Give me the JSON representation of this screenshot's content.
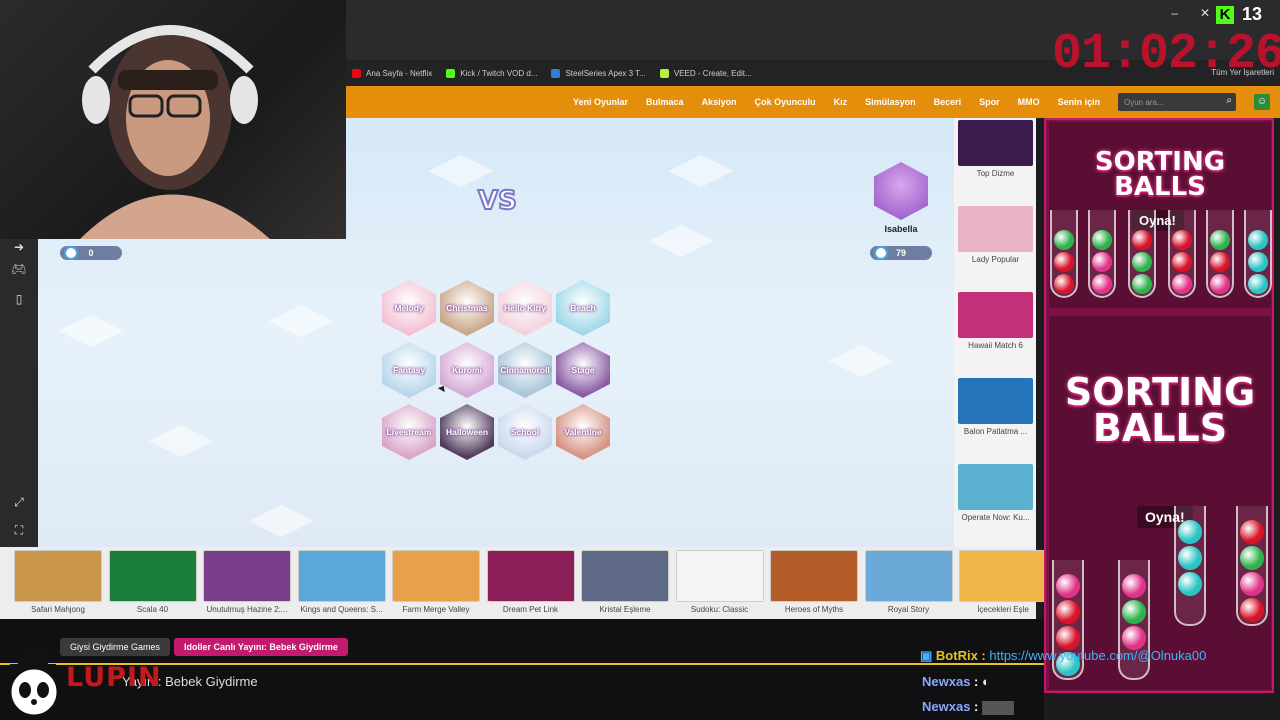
{
  "browser": {
    "window_controls": [
      "–",
      "✕"
    ],
    "bookmarks": [
      {
        "label": "Ana Sayfa - Netflix",
        "color": "#e50914"
      },
      {
        "label": "Kick / Twitch VOD d...",
        "color": "#53fc18"
      },
      {
        "label": "SteelSeries Apex 3 T...",
        "color": "#2f7fd8"
      },
      {
        "label": "VEED - Create, Edit...",
        "color": "#b6f03a"
      }
    ],
    "all_bookmarks": "Tüm Yer İşaretleri"
  },
  "site_nav": {
    "items": [
      "Yeni Oyunlar",
      "Bulmaca",
      "Aksiyon",
      "Çok Oyunculu",
      "Kız",
      "Simülasyon",
      "Beceri",
      "Spor",
      "MMO",
      "Senin için"
    ],
    "search_placeholder": "Oyun ara...",
    "accent": "#e58e0b"
  },
  "game": {
    "vs_label": "VS",
    "player_left_score": "0",
    "opponent_name": "Isabella",
    "opponent_score": "79",
    "themes": [
      {
        "label": "Melody",
        "color": "#f4c1d4"
      },
      {
        "label": "Christmas",
        "color": "#c9a78a"
      },
      {
        "label": "Hello Kitty",
        "color": "#f4d2dd"
      },
      {
        "label": "Beach",
        "color": "#9fd8e8"
      },
      {
        "label": "Fantasy",
        "color": "#b7d6ec"
      },
      {
        "label": "Kuromi",
        "color": "#d5a9d6"
      },
      {
        "label": "Cinnamoroll",
        "color": "#a9c4d9"
      },
      {
        "label": "Stage",
        "color": "#8a5aa3"
      },
      {
        "label": "Livestream",
        "color": "#d8a5c9"
      },
      {
        "label": "Halloween",
        "color": "#4f3a5a"
      },
      {
        "label": "School",
        "color": "#c8d9ec"
      },
      {
        "label": "Valentine",
        "color": "#d69282"
      }
    ]
  },
  "right_games": [
    {
      "label": "Top Dizme",
      "color": "#3b1b4d"
    },
    {
      "label": "Lady Popular",
      "color": "#e9b5c5"
    },
    {
      "label": "Hawaii Match 6",
      "color": "#c2307a"
    },
    {
      "label": "Balon Patlatma ...",
      "color": "#2573b8"
    },
    {
      "label": "Operate Now: Ku...",
      "color": "#5bb0cf"
    }
  ],
  "bottom_games": [
    {
      "label": "Safari Mahjong",
      "color": "#c9964a"
    },
    {
      "label": "Scala 40",
      "color": "#1b7d3a"
    },
    {
      "label": "Unutulmuş Hazine 2:...",
      "color": "#7a3d8a"
    },
    {
      "label": "Kings and Queens: S...",
      "color": "#5aa8d8"
    },
    {
      "label": "Farm Merge Valley",
      "color": "#e8a04a"
    },
    {
      "label": "Dream Pet Link",
      "color": "#8b1e57"
    },
    {
      "label": "Kristal Eşleme",
      "color": "#5e6a85"
    },
    {
      "label": "Sudoku: Classic",
      "color": "#f4f4f4"
    },
    {
      "label": "Heroes of Myths",
      "color": "#b55d2a"
    },
    {
      "label": "Royal Story",
      "color": "#6ba9d8"
    },
    {
      "label": "İçecekleri Eşle",
      "color": "#f0b64a"
    }
  ],
  "ad": {
    "title_top": "SORTING\nBALLS",
    "title_bottom": "SORTING\nBALLS",
    "play_label": "Oyna!",
    "bg": "#7a1247"
  },
  "stream": {
    "timer": "01:02:26",
    "viewer_count": "13",
    "tags": [
      "Giysi Giydirme Games",
      "Idoller Canlı Yayını: Bebek Giydirme"
    ],
    "subtitle": "Yayını: Bebek Giydirme",
    "subtitle_prefix": "Idoller Canlı",
    "brand": "LUPIN",
    "chat": [
      {
        "user": "BotRix",
        "text": "https://www.youtube.com/@Olnuka00",
        "user_color": "#e8c21a",
        "text_color": "#3fb3ff"
      },
      {
        "user": "Newxas",
        "text": "",
        "user_color": "#8aa7ff"
      },
      {
        "user": "Newxas",
        "text": "",
        "user_color": "#8aa7ff"
      }
    ]
  }
}
